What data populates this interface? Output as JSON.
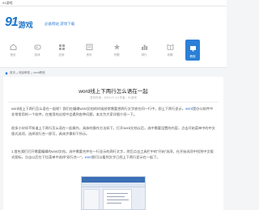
{
  "tab": {
    "title": "91游戏"
  },
  "header": {
    "logo_number": "91",
    "logo_text": "游戏",
    "logo_sub": "91wan.com",
    "slogan": "必备网站 游戏下载"
  },
  "nav": {
    "items": [
      {
        "label": "首页",
        "icon": "home-icon"
      },
      {
        "label": "游戏",
        "icon": "gamepad-icon"
      },
      {
        "label": "应用",
        "icon": "grid-icon"
      },
      {
        "label": "资讯",
        "icon": "news-icon"
      },
      {
        "label": "专题",
        "icon": "star-icon"
      },
      {
        "label": "排行",
        "icon": "rank-icon"
      },
      {
        "label": "攻略",
        "icon": "book-icon"
      },
      {
        "label": "教程",
        "icon": "monitor-icon"
      }
    ],
    "active_index": 7,
    "accent": "#2a7fd6"
  },
  "breadcrumb": {
    "items": [
      "首页",
      ">",
      "电脑教程",
      ">",
      "word教程"
    ]
  },
  "article": {
    "title": "word线上下两行怎么语在一起",
    "meta": "发布时间：2021-07-13 作者：91游戏",
    "p1a": "word线上下两行怎么语在一起呢？我们在编辑word文档的时候经常需要把两行文字放在同一行中，即上下两行显示，",
    "p1_link": "word",
    "p1b": "是办公软件中非常常用的一个软件，在使用的过程中会遇到各种问题，本文为大家详细介绍一下。",
    "p2": "很多小伙伴不知道上下两行怎么语在一起操作，具体的操作方法如下，打开word文档以后，选中需要设置的内容，点击开始菜单中的中文版式选项，选择双行合一即可，具体步骤如下所示。",
    "p3a": "1.首先我们打开需要编辑的word文档，选中需要合并在一行显示的两行文字，然后点击工具栏中的“开始”选项，在开始选项中找到中文版式图标，点击以后在下拉菜单中选择“双行合一”，",
    "p3_link": "word",
    "p3b": "即可以看到文字已经上下两行显示在一起了。"
  }
}
